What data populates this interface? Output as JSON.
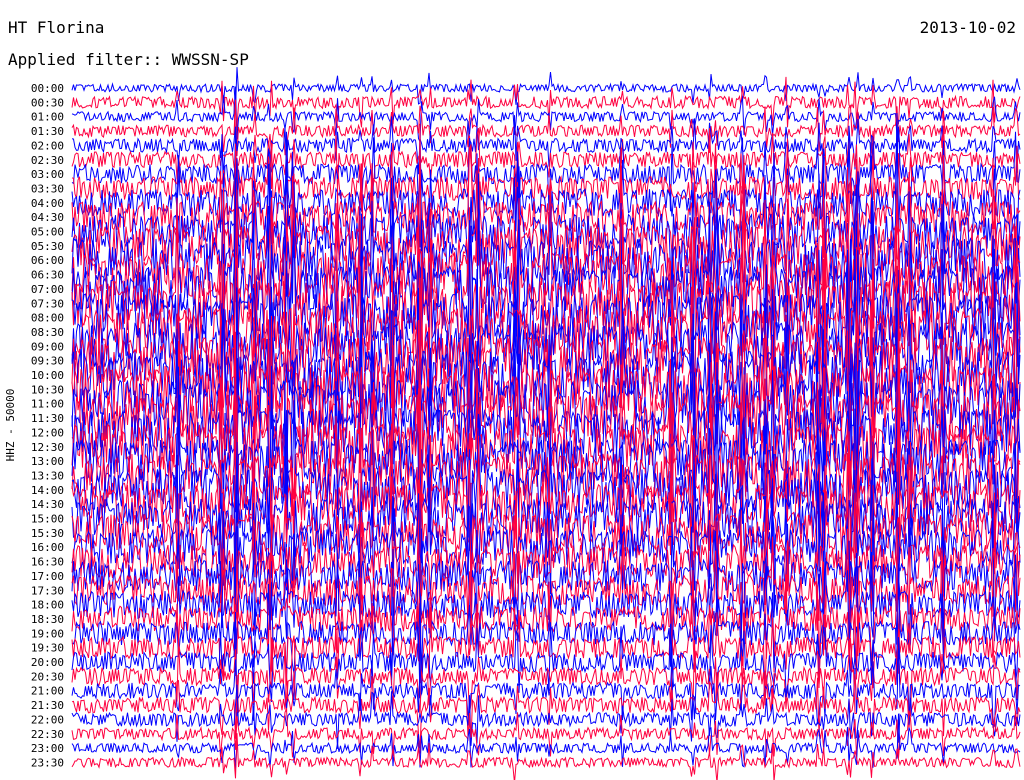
{
  "header": {
    "station": "HT Florina",
    "date": "2013-10-02",
    "filter": "Applied filter:: WWSSN-SP"
  },
  "colors": {
    "trace_a": "#0000ff",
    "trace_b": "#ff0040",
    "background": "#ffffff"
  },
  "chart_data": {
    "type": "line",
    "title": "HT Florina",
    "subtitle": "Applied filter:: WWSSN-SP",
    "date": "2013-10-02",
    "ylabel": "HHZ - 50000",
    "xlabel": "",
    "grid": false,
    "legend": "none",
    "series_colors": [
      "#0000ff",
      "#ff0040"
    ],
    "row_labels": [
      "00:00",
      "00:30",
      "01:00",
      "01:30",
      "02:00",
      "02:30",
      "03:00",
      "03:30",
      "04:00",
      "04:30",
      "05:00",
      "05:30",
      "06:00",
      "06:30",
      "07:00",
      "07:30",
      "08:00",
      "08:30",
      "09:00",
      "09:30",
      "10:00",
      "10:30",
      "11:00",
      "11:30",
      "12:00",
      "12:30",
      "13:00",
      "13:30",
      "14:00",
      "14:30",
      "15:00",
      "15:30",
      "16:00",
      "16:30",
      "17:00",
      "17:30",
      "18:00",
      "18:30",
      "19:00",
      "19:30",
      "20:00",
      "20:30",
      "21:00",
      "21:30",
      "22:00",
      "22:30",
      "23:00",
      "23:30"
    ],
    "row_amplitude": [
      0.4,
      0.6,
      0.5,
      0.6,
      0.7,
      0.8,
      1.0,
      1.2,
      1.4,
      1.6,
      1.8,
      2.0,
      2.2,
      2.2,
      2.3,
      2.3,
      2.4,
      2.4,
      2.4,
      2.4,
      2.4,
      2.4,
      2.4,
      2.4,
      2.3,
      2.3,
      2.2,
      2.2,
      2.1,
      2.0,
      2.0,
      1.9,
      1.8,
      1.7,
      1.6,
      1.5,
      1.4,
      1.3,
      1.2,
      1.1,
      1.0,
      0.9,
      0.8,
      0.8,
      0.7,
      0.6,
      0.5,
      0.5
    ]
  }
}
